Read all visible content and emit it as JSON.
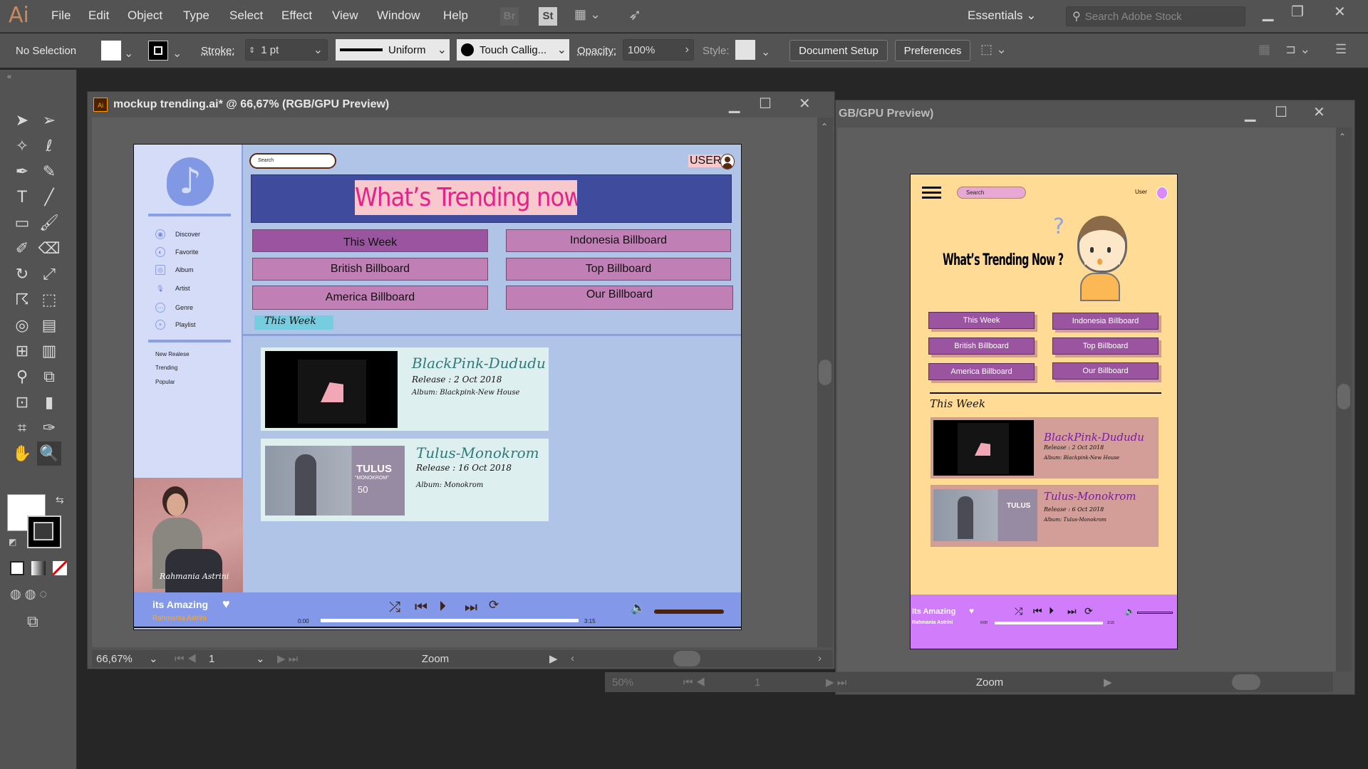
{
  "app": {
    "logo": "Ai",
    "menu": [
      "File",
      "Edit",
      "Object",
      "Type",
      "Select",
      "Effect",
      "View",
      "Window",
      "Help"
    ],
    "bridge": "Br",
    "stock": "St",
    "workspace": "Essentials",
    "stock_search_placeholder": "Search Adobe Stock"
  },
  "options": {
    "selection": "No Selection",
    "stroke_label": "Stroke:",
    "stroke_value": "1 pt",
    "profile": "Uniform",
    "brush": "Touch Callig...",
    "opacity_label": "Opacity:",
    "opacity_value": "100%",
    "style_label": "Style:",
    "document_setup": "Document Setup",
    "preferences": "Preferences"
  },
  "doc1": {
    "title": "mockup trending.ai* @ 66,67% (RGB/GPU Preview)",
    "zoom": "66,67%",
    "page": "1",
    "status": "Zoom"
  },
  "doc2": {
    "title": "GB/GPU Preview)",
    "zoom": "50%",
    "page": "1",
    "status": "Zoom"
  },
  "desktop": {
    "search_placeholder": "Search",
    "user": "USER",
    "banner": "What’s Trending now?",
    "nav": [
      "Discover",
      "Favorite",
      "Album",
      "Artist",
      "Genre",
      "Playlist"
    ],
    "nav2": [
      "New Realese",
      "Trending",
      "Popular"
    ],
    "buttons": [
      "This Week",
      "Indonesia Billboard",
      "British Billboard",
      "Top Billboard",
      "America Billboard",
      "Our Billboard"
    ],
    "section": "This Week",
    "cards": [
      {
        "title": "BlackPink-Dududu",
        "release": "Release : 2 Oct 2018",
        "album": "Album: Blackpink-New House"
      },
      {
        "title": "Tulus-Monokrom",
        "release": "Release : 16 Oct 2018",
        "album": "Album: Monokrom",
        "cover_text": "TULUS",
        "cover_sub": "\"MONOKROM\"",
        "cover_num": "50"
      }
    ],
    "photo_signature": "Rahmania Astrini",
    "player": {
      "song": "its Amazing",
      "artist": "Rahmania Astrini",
      "current": "0:00",
      "total": "3:15",
      "progress": 1.0
    }
  },
  "mobile": {
    "search_placeholder": "Search",
    "user": "User",
    "title": "What’s Trending Now ?",
    "buttons": [
      "This Week",
      "Indonesia Billboard",
      "British Billboard",
      "Top Billboard",
      "America Billboard",
      "Our Billboard"
    ],
    "section": "This Week",
    "cards": [
      {
        "title": "BlackPink-Dududu",
        "release": "Release : 2 Oct 2018",
        "album": "Album: Blackpink-New House"
      },
      {
        "title": "Tulus-Monokrom",
        "release": "Release : 6 Oct 2018",
        "album": "Album: Tulus-Monokrom",
        "cover_text": "TULUS"
      }
    ],
    "player": {
      "song": "Its Amazing",
      "artist": "Rahmania Astrini",
      "current": "0:00",
      "total": "3:15",
      "progress": 1.0
    }
  },
  "colors": {
    "desktop_bg": "#b0c4e8",
    "banner": "#3f4c9e",
    "banner_text": "#e8208c",
    "mobile_bg": "#ffdb96",
    "mobile_player": "#d17cfa",
    "desktop_player": "#8398e8"
  }
}
